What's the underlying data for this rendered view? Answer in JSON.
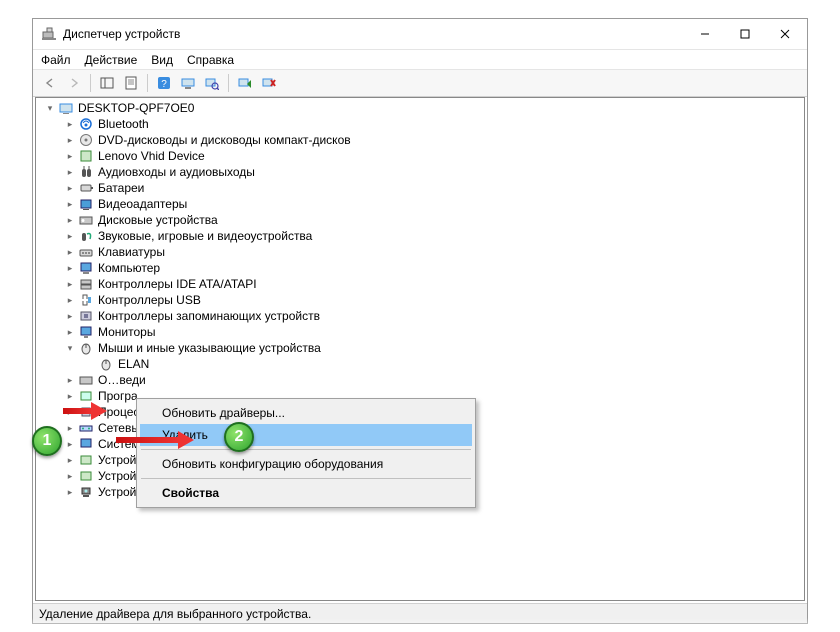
{
  "window": {
    "title": "Диспетчер устройств"
  },
  "menu": {
    "file": "Файл",
    "action": "Действие",
    "view": "Вид",
    "help": "Справка"
  },
  "tree": {
    "root": "DESKTOP-QPF7OE0",
    "items": [
      "Bluetooth",
      "DVD-дисководы и дисководы компакт-дисков",
      "Lenovo Vhid Device",
      "Аудиовходы и аудиовыходы",
      "Батареи",
      "Видеоадаптеры",
      "Дисковые устройства",
      "Звуковые, игровые и видеоустройства",
      "Клавиатуры",
      "Компьютер",
      "Контроллеры IDE ATA/ATAPI",
      "Контроллеры USB",
      "Контроллеры запоминающих устройств",
      "Мониторы"
    ],
    "expandedCat": "Мыши и иные указывающие устройства",
    "child": "ELAN",
    "tail": [
      "О…веди",
      "Програ",
      "Процес",
      "Сетевы",
      "Системн",
      "Устройства HID (Human Interface Devices)",
      "Устройства безопасности",
      "Устройства обработки изображений"
    ]
  },
  "context": {
    "update": "Обновить драйверы...",
    "delete": "Удалить",
    "rescan": "Обновить конфигурацию оборудования",
    "props": "Свойства"
  },
  "status": "Удаление драйвера для выбранного устройства.",
  "callouts": {
    "one": "1",
    "two": "2"
  }
}
